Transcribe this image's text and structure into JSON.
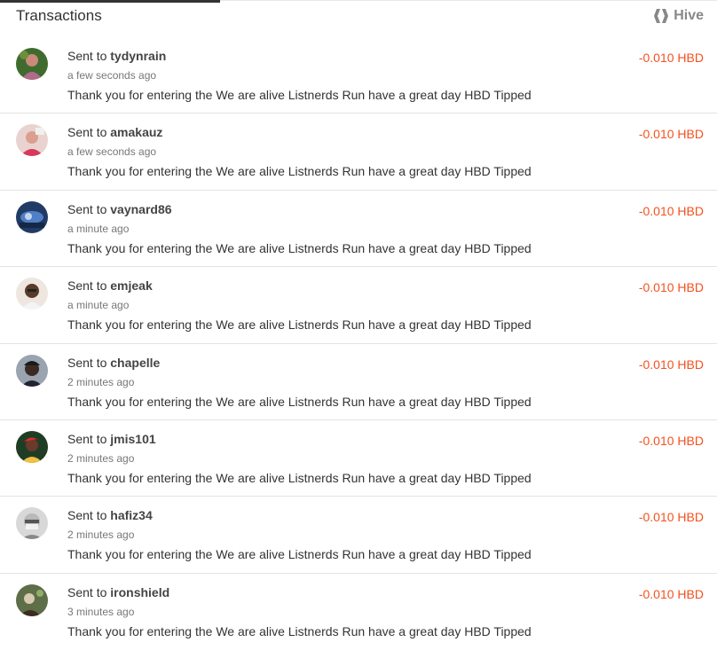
{
  "header": {
    "title": "Transactions",
    "brand": "Hive"
  },
  "colors": {
    "amount": "#f4511e",
    "divider": "#e3e3e3"
  },
  "transactions": [
    {
      "prefix": "Sent to",
      "user": "tydynrain",
      "time": "a few seconds ago",
      "memo": "Thank you for entering the We are alive Listnerds Run have a great day HBD Tipped",
      "amount": "-0.010 HBD",
      "avatar": "avatar-photo"
    },
    {
      "prefix": "Sent to",
      "user": "amakauz",
      "time": "a few seconds ago",
      "memo": "Thank you for entering the We are alive Listnerds Run have a great day HBD Tipped",
      "amount": "-0.010 HBD",
      "avatar": "avatar-photo"
    },
    {
      "prefix": "Sent to",
      "user": "vaynard86",
      "time": "a minute ago",
      "memo": "Thank you for entering the We are alive Listnerds Run have a great day HBD Tipped",
      "amount": "-0.010 HBD",
      "avatar": "avatar-photo"
    },
    {
      "prefix": "Sent to",
      "user": "emjeak",
      "time": "a minute ago",
      "memo": "Thank you for entering the We are alive Listnerds Run have a great day HBD Tipped",
      "amount": "-0.010 HBD",
      "avatar": "avatar-photo"
    },
    {
      "prefix": "Sent to",
      "user": "chapelle",
      "time": "2 minutes ago",
      "memo": "Thank you for entering the We are alive Listnerds Run have a great day HBD Tipped",
      "amount": "-0.010 HBD",
      "avatar": "avatar-photo"
    },
    {
      "prefix": "Sent to",
      "user": "jmis101",
      "time": "2 minutes ago",
      "memo": "Thank you for entering the We are alive Listnerds Run have a great day HBD Tipped",
      "amount": "-0.010 HBD",
      "avatar": "avatar-photo"
    },
    {
      "prefix": "Sent to",
      "user": "hafiz34",
      "time": "2 minutes ago",
      "memo": "Thank you for entering the We are alive Listnerds Run have a great day HBD Tipped",
      "amount": "-0.010 HBD",
      "avatar": "avatar-photo"
    },
    {
      "prefix": "Sent to",
      "user": "ironshield",
      "time": "3 minutes ago",
      "memo": "Thank you for entering the We are alive Listnerds Run have a great day HBD Tipped",
      "amount": "-0.010 HBD",
      "avatar": "avatar-photo"
    }
  ]
}
